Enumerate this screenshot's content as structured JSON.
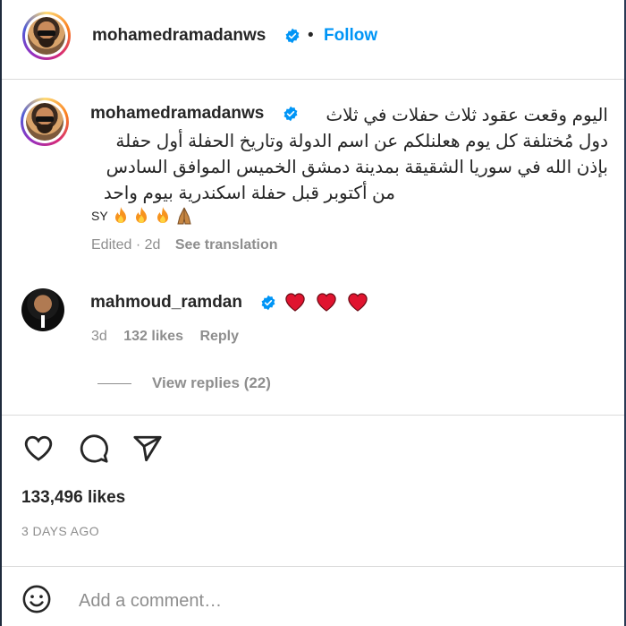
{
  "header": {
    "username": "mohamedramadanws",
    "separator": "•",
    "follow_label": "Follow"
  },
  "caption": {
    "username": "mohamedramadanws",
    "lines": [
      "اليوم وقعت عقود ثلاث حفلات في ثلاث",
      "دول مُختلفة كل يوم هعلنلكم عن اسم الدولة وتاريخ الحفلة أول حفلة",
      "بإذن الله في سوريا الشقيقة بمدينة دمشق الخميس الموافق السادس",
      "من أكتوبر قبل حفلة اسكندرية بيوم واحد"
    ],
    "emoji_prefix": "SY",
    "emoji_names": [
      "fire-emoji",
      "fire-emoji",
      "fire-emoji",
      "praying-hands-emoji"
    ],
    "edited": "Edited · 2d",
    "see_translation": "See translation"
  },
  "comment": {
    "username": "mahmoud_ramdan",
    "hearts": [
      "red-heart",
      "red-heart",
      "red-heart"
    ],
    "age": "3d",
    "likes": "132 likes",
    "reply_label": "Reply",
    "view_replies": "View replies (22)"
  },
  "actions": {
    "icons": [
      "heart-icon",
      "comment-icon",
      "share-icon"
    ]
  },
  "stats": {
    "likes": "133,496 likes",
    "date": "3 DAYS AGO"
  },
  "composer": {
    "placeholder": "Add a comment…"
  },
  "colors": {
    "accent": "#0095f6",
    "verified": "#0095f6",
    "heart": "#ed4956",
    "muted": "#8e8e8e"
  }
}
